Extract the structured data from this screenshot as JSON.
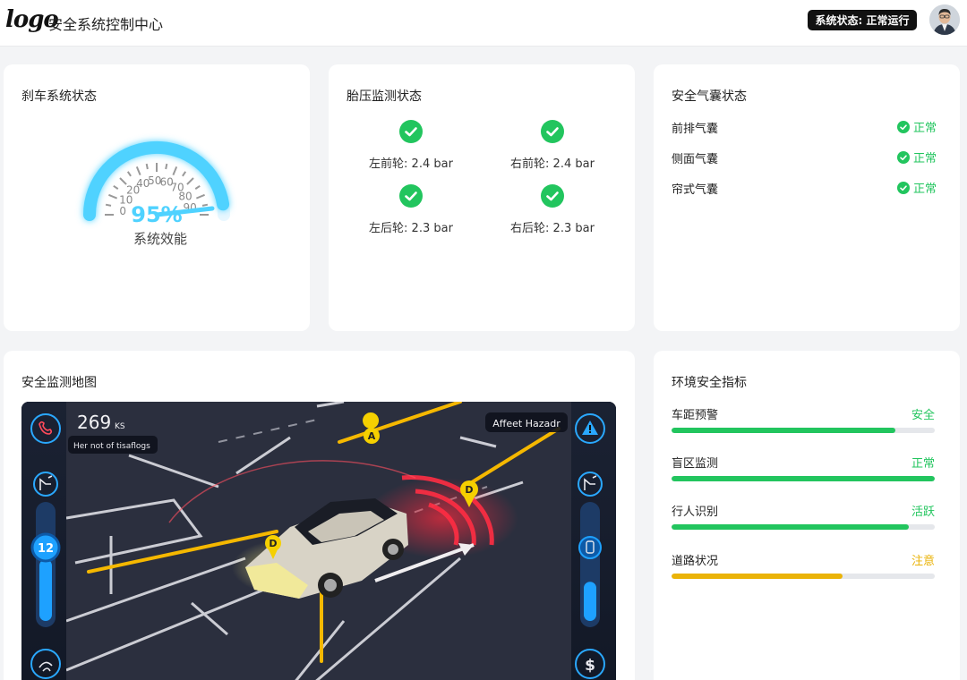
{
  "header": {
    "logo_text": "logo",
    "title": "安全系统控制中心",
    "status_badge": "系统状态: 正常运行",
    "avatar_icon": "user-avatar"
  },
  "brake": {
    "title": "刹车系统状态",
    "gauge_value_pct": 95,
    "gauge_value_text": "95%",
    "gauge_label": "系统效能",
    "gauge_ticks": [
      "0",
      "10",
      "20",
      "40",
      "50",
      "60",
      "70",
      "80",
      "90"
    ],
    "gauge_color": "#4fd2ff"
  },
  "tire": {
    "title": "胎压监测状态",
    "items": [
      {
        "text": "左前轮: 2.4 bar",
        "icon": "check-circle-icon"
      },
      {
        "text": "右前轮: 2.4 bar",
        "icon": "check-circle-icon"
      },
      {
        "text": "左后轮: 2.3 bar",
        "icon": "check-circle-icon"
      },
      {
        "text": "右后轮: 2.3 bar",
        "icon": "check-circle-icon"
      }
    ]
  },
  "airbag": {
    "title": "安全气囊状态",
    "items": [
      {
        "label": "前排气囊",
        "status": "正常"
      },
      {
        "label": "侧面气囊",
        "status": "正常"
      },
      {
        "label": "帘式气囊",
        "status": "正常"
      }
    ]
  },
  "map": {
    "title": "安全监测地图",
    "speed": "269",
    "speed_unit": "KS",
    "tooltip": "Her not of tisaflogs",
    "alert": "Affeet Hazadr",
    "left_dial_value": "12",
    "left_dial_level": 0.55,
    "right_dial_level": 0.35,
    "markers": [
      "A",
      "D",
      "D"
    ],
    "icons": [
      "phone-icon",
      "seat-icon",
      "wiper-icon",
      "warning-icon",
      "seat-icon",
      "phone-icon",
      "dollar-icon"
    ]
  },
  "env": {
    "title": "环境安全指标",
    "items": [
      {
        "label": "车距预警",
        "status": "安全",
        "level": 0.85,
        "color": "#22c55e"
      },
      {
        "label": "盲区监测",
        "status": "正常",
        "level": 1.0,
        "color": "#22c55e"
      },
      {
        "label": "行人识别",
        "status": "活跃",
        "level": 0.9,
        "color": "#22c55e"
      },
      {
        "label": "道路状况",
        "status": "注意",
        "level": 0.65,
        "color": "#eab308"
      }
    ]
  },
  "colors": {
    "ok_green": "#22c55e",
    "warn_yellow": "#eab308",
    "gauge_blue": "#4fd2ff"
  }
}
